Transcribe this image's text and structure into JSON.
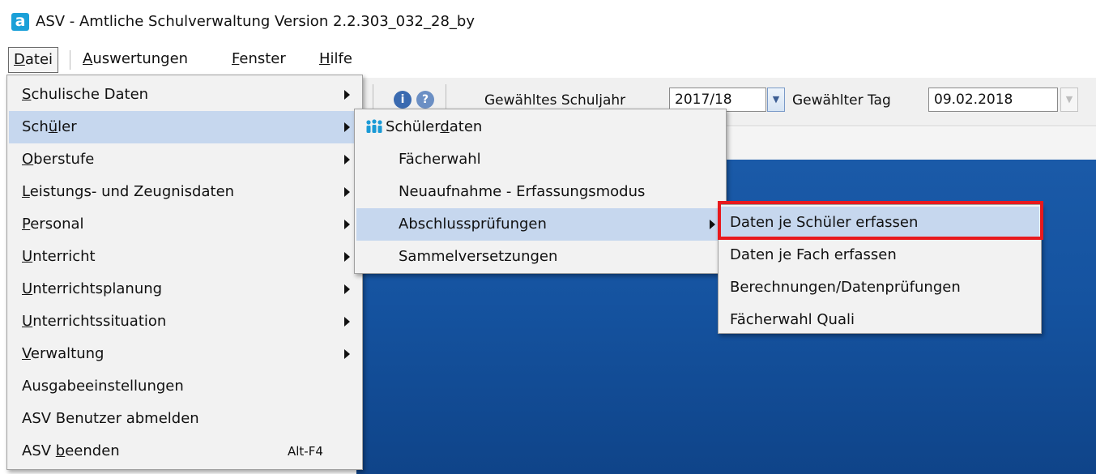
{
  "window": {
    "logo_letter": "a",
    "title": "ASV - Amtliche Schulverwaltung Version 2.2.303_032_28_by"
  },
  "menubar": [
    {
      "pre": "",
      "u": "D",
      "post": "atei"
    },
    {
      "pre": "",
      "u": "A",
      "post": "uswertungen"
    },
    {
      "pre": "",
      "u": "F",
      "post": "enster"
    },
    {
      "pre": "",
      "u": "H",
      "post": "ilfe"
    }
  ],
  "toolbar": {
    "schuljahr_label": "Gewähltes Schuljahr",
    "schuljahr_value": "2017/18",
    "tag_label": "Gewählter Tag",
    "tag_value": "09.02.2018"
  },
  "datei_menu": [
    {
      "pre": "",
      "u": "S",
      "post": "chulische Daten",
      "submenu": true
    },
    {
      "pre": "Sch",
      "u": "ü",
      "post": "ler",
      "submenu": true
    },
    {
      "pre": "",
      "u": "O",
      "post": "berstufe",
      "submenu": true
    },
    {
      "pre": "",
      "u": "L",
      "post": "eistungs- und Zeugnisdaten",
      "submenu": true
    },
    {
      "pre": "",
      "u": "P",
      "post": "ersonal",
      "submenu": true
    },
    {
      "pre": "",
      "u": "U",
      "post": "nterricht",
      "submenu": true
    },
    {
      "pre": "",
      "u": "U",
      "post": "nterrichtsplanung",
      "submenu": true
    },
    {
      "pre": "",
      "u": "U",
      "post": "nterrichtssituation",
      "submenu": true
    },
    {
      "pre": "",
      "u": "V",
      "post": "erwaltung",
      "submenu": true
    },
    {
      "pre": "Ausgabeeinstellungen",
      "u": "",
      "post": "",
      "submenu": false
    },
    {
      "pre": "ASV Benutzer abmelden",
      "u": "",
      "post": "",
      "submenu": false
    },
    {
      "pre": "ASV ",
      "u": "b",
      "post": "eenden",
      "submenu": false,
      "shortcut": "Alt-F4"
    }
  ],
  "schueler_menu": [
    {
      "pre": "Schüler",
      "u": "d",
      "post": "aten",
      "submenu": false,
      "icon": "people-icon"
    },
    {
      "pre": "Fächerwahl",
      "u": "",
      "post": "",
      "submenu": false
    },
    {
      "pre": "Neuaufnahme - Erfassungsmodus",
      "u": "",
      "post": "",
      "submenu": false
    },
    {
      "pre": "Abschlussprüfungen",
      "u": "",
      "post": "",
      "submenu": true
    },
    {
      "pre": "Sammelversetzungen",
      "u": "",
      "post": "",
      "submenu": false
    }
  ],
  "abschluss_menu": [
    {
      "label": "Daten je Schüler erfassen"
    },
    {
      "label": "Daten je Fach erfassen"
    },
    {
      "label": "Berechnungen/Datenprüfungen"
    },
    {
      "label": "Fächerwahl Quali"
    }
  ],
  "colors": {
    "highlight": "#c6d7ee",
    "annotation_border": "#e8191d",
    "desktop": "#1553a0"
  }
}
